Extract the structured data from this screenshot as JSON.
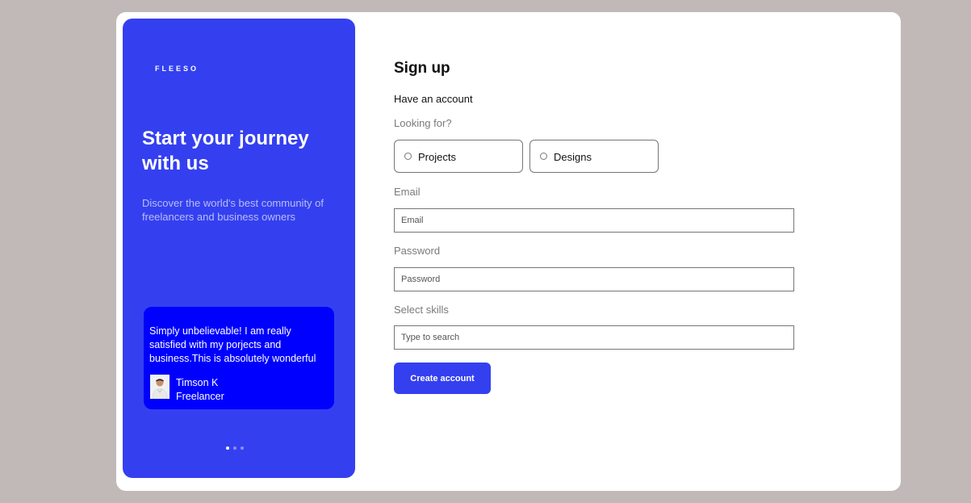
{
  "brand": {
    "logo": "FLEESO"
  },
  "hero": {
    "title": "Start your journey with us",
    "subtitle": "Discover the world's best community of freelancers and business owners"
  },
  "testimonial": {
    "quote": "Simply unbelievable! I am really satisfied with my porjects and business.This is absolutely wonderful",
    "author_name": "Timson K",
    "author_role": "Freelancer",
    "avatar_icon": "person-avatar-icon",
    "slide_count": 3,
    "active_slide": 1
  },
  "form": {
    "title": "Sign up",
    "have_account": "Have an account",
    "looking_for_label": "Looking for?",
    "options": [
      {
        "label": "Projects",
        "selected": false
      },
      {
        "label": "Designs",
        "selected": false
      }
    ],
    "email": {
      "label": "Email",
      "placeholder": "Email",
      "value": ""
    },
    "password": {
      "label": "Password",
      "placeholder": "Password",
      "value": ""
    },
    "skills": {
      "label": "Select skills",
      "placeholder": "Type to search",
      "value": ""
    },
    "submit_label": "Create account"
  },
  "colors": {
    "background": "#c1b9b8",
    "panel": "#3440f0",
    "testimonial_card": "#0000ff",
    "accent": "#3440f0"
  }
}
